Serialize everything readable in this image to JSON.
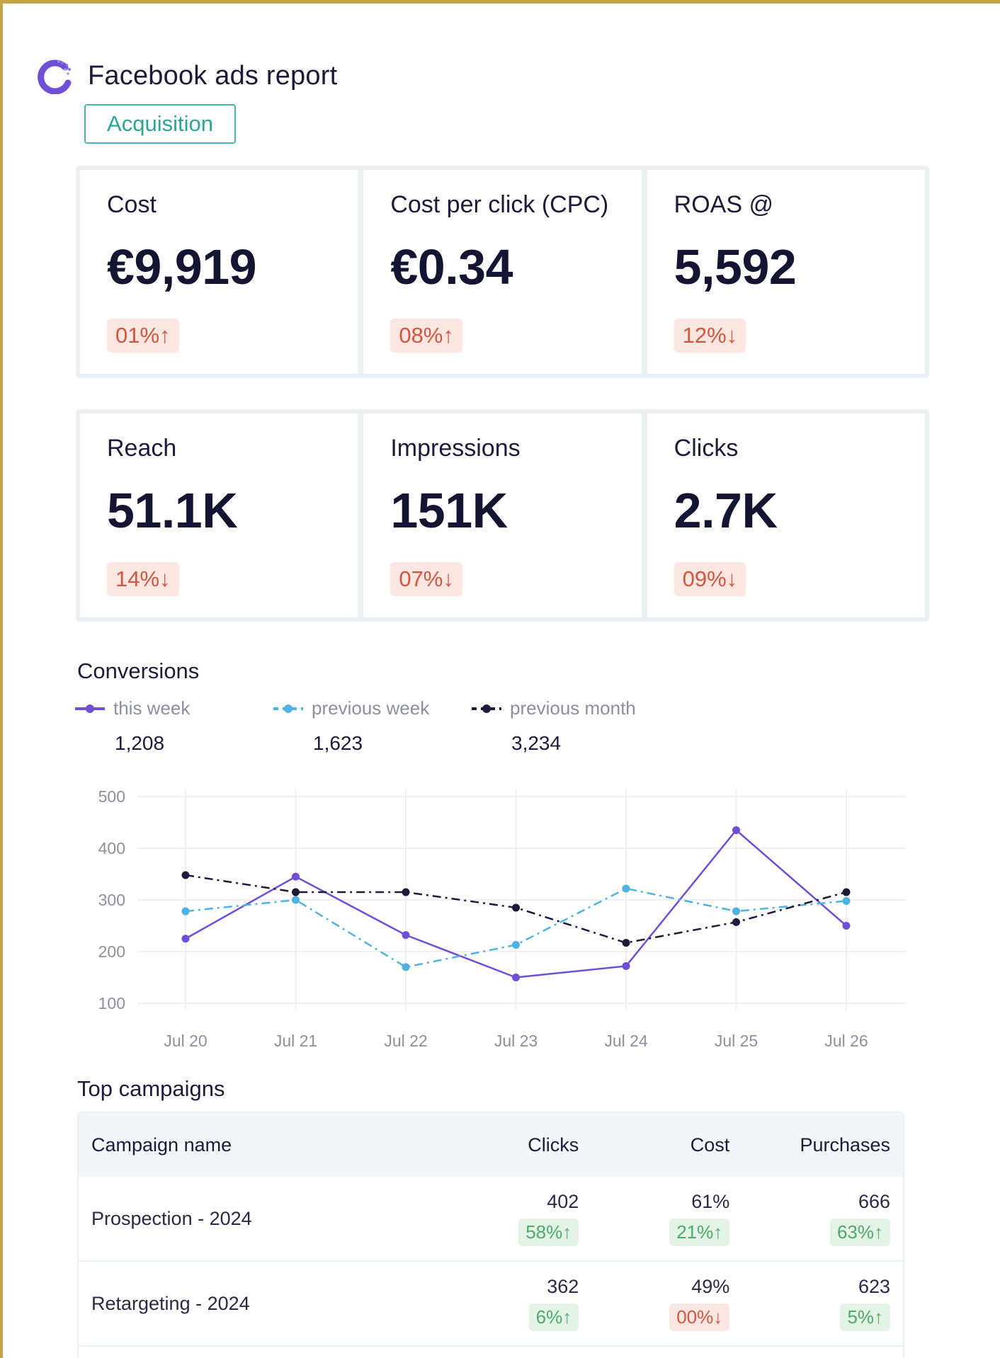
{
  "header": {
    "title": "Facebook ads report",
    "tag": "Acquisition"
  },
  "kpis_row1": [
    {
      "label": "Cost",
      "value": "€9,919",
      "delta": "01%↑"
    },
    {
      "label": "Cost per click (CPC)",
      "value": "€0.34",
      "delta": "08%↑"
    },
    {
      "label": "ROAS @",
      "value": "5,592",
      "delta": "12%↓"
    }
  ],
  "kpis_row2": [
    {
      "label": "Reach",
      "value": "51.1K",
      "delta": "14%↓"
    },
    {
      "label": "Impressions",
      "value": "151K",
      "delta": "07%↓"
    },
    {
      "label": "Clicks",
      "value": "2.7K",
      "delta": "09%↓"
    }
  ],
  "conversions": {
    "title": "Conversions",
    "legend": [
      {
        "label": "this week",
        "value": "1,208"
      },
      {
        "label": "previous week",
        "value": "1,623"
      },
      {
        "label": "previous month",
        "value": "3,234"
      }
    ]
  },
  "colors": {
    "this_week": "#6e4fd6",
    "previous_week": "#4fb3e0",
    "previous_month": "#1c1b3a",
    "negative": "#d0573f",
    "positive": "#4fa968",
    "tag": "#2aa596"
  },
  "chart_data": {
    "type": "line",
    "x": [
      "Jul 20",
      "Jul 21",
      "Jul 22",
      "Jul 23",
      "Jul 24",
      "Jul 25",
      "Jul 26"
    ],
    "yticks": [
      100,
      200,
      300,
      400,
      500
    ],
    "ylim": [
      100,
      500
    ],
    "grid": true,
    "series": [
      {
        "name": "this week",
        "values": [
          225,
          345,
          232,
          150,
          172,
          435,
          250
        ],
        "style": "solid"
      },
      {
        "name": "previous week",
        "values": [
          278,
          300,
          170,
          213,
          322,
          278,
          298
        ],
        "style": "dashdot"
      },
      {
        "name": "previous month",
        "values": [
          348,
          315,
          315,
          285,
          217,
          257,
          315
        ],
        "style": "dashdot"
      }
    ]
  },
  "campaigns": {
    "title": "Top campaigns",
    "headers": {
      "name": "Campaign name",
      "clicks": "Clicks",
      "cost": "Cost",
      "purchases": "Purchases"
    },
    "rows": [
      {
        "name": "Prospection - 2024",
        "clicks": "402",
        "clicks_delta": "58%↑",
        "cost": "61%",
        "cost_delta": "21%↑",
        "purchases": "666",
        "purchases_delta": "63%↑"
      },
      {
        "name": "Retargeting - 2024",
        "clicks": "362",
        "clicks_delta": "6%↑",
        "cost": "49%",
        "cost_delta": "00%↓",
        "purchases": "623",
        "purchases_delta": "5%↑"
      }
    ]
  }
}
